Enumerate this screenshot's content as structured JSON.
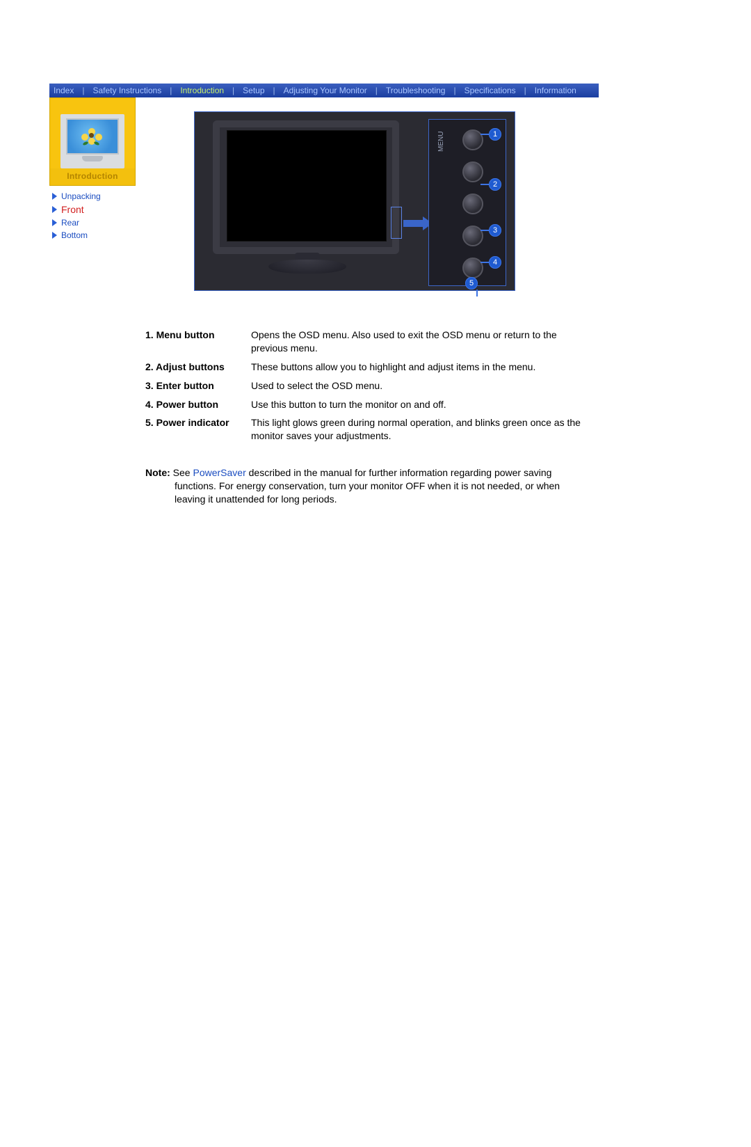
{
  "nav": {
    "items": [
      "Index",
      "Safety Instructions",
      "Introduction",
      "Setup",
      "Adjusting Your Monitor",
      "Troubleshooting",
      "Specifications",
      "Information"
    ],
    "active_index": 2
  },
  "sidebar": {
    "section_label": "Introduction",
    "items": [
      {
        "label": "Unpacking",
        "active": false
      },
      {
        "label": "Front",
        "active": true
      },
      {
        "label": "Rear",
        "active": false
      },
      {
        "label": "Bottom",
        "active": false
      }
    ]
  },
  "illustration": {
    "callouts": [
      "1",
      "2",
      "3",
      "4",
      "5"
    ],
    "panel_label": "MENU"
  },
  "definitions": [
    {
      "num": "1.",
      "term": "Menu button",
      "desc": "Opens the OSD menu. Also used to exit the OSD menu or return to the previous menu."
    },
    {
      "num": "2.",
      "term": "Adjust buttons",
      "desc": "These buttons allow you to highlight and adjust items in the menu."
    },
    {
      "num": "3.",
      "term": "Enter button",
      "desc": "Used to select the OSD menu."
    },
    {
      "num": "4.",
      "term": "Power button",
      "desc": "Use this button to turn the monitor on and off."
    },
    {
      "num": "5.",
      "term": "Power indicator",
      "desc": "This light glows green during normal operation, and blinks green once as the monitor saves your adjustments."
    }
  ],
  "note": {
    "label": "Note:",
    "pre": "See ",
    "link": "PowerSaver",
    "post1": " described in the manual for further information regarding power saving",
    "line2": "functions. For energy conservation, turn your monitor OFF when it is not needed, or when",
    "line3": "leaving it unattended for long periods."
  }
}
